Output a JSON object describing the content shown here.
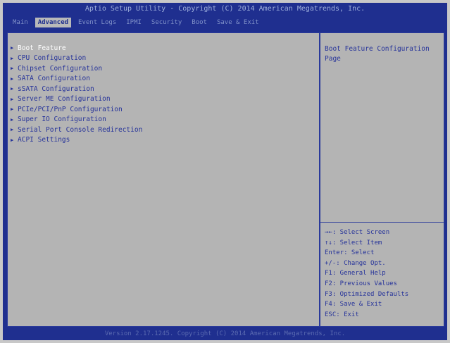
{
  "header": {
    "title": "Aptio Setup Utility - Copyright (C) 2014 American Megatrends, Inc."
  },
  "tabs": [
    {
      "label": "Main"
    },
    {
      "label": "Advanced"
    },
    {
      "label": "Event Logs"
    },
    {
      "label": "IPMI"
    },
    {
      "label": "Security"
    },
    {
      "label": "Boot"
    },
    {
      "label": "Save & Exit"
    }
  ],
  "menu": {
    "items": [
      {
        "label": "Boot Feature"
      },
      {
        "label": "CPU Configuration"
      },
      {
        "label": "Chipset Configuration"
      },
      {
        "label": "SATA Configuration"
      },
      {
        "label": "sSATA Configuration"
      },
      {
        "label": "Server ME Configuration"
      },
      {
        "label": "PCIe/PCI/PnP Configuration"
      },
      {
        "label": "Super IO Configuration"
      },
      {
        "label": "Serial Port Console Redirection"
      },
      {
        "label": "ACPI Settings"
      }
    ]
  },
  "help": {
    "text": "Boot Feature Configuration Page"
  },
  "keys": [
    {
      "label": "→←: Select Screen"
    },
    {
      "label": "↑↓: Select Item"
    },
    {
      "label": "Enter: Select"
    },
    {
      "label": "+/-: Change Opt."
    },
    {
      "label": "F1: General Help"
    },
    {
      "label": "F2: Previous Values"
    },
    {
      "label": "F3: Optimized Defaults"
    },
    {
      "label": "F4: Save & Exit"
    },
    {
      "label": "ESC: Exit"
    }
  ],
  "footer": {
    "text": "Version 2.17.1245. Copyright (C) 2014 American Megatrends, Inc."
  },
  "colors": {
    "bios_blue": "#1f2f8f",
    "panel_gray": "#b4b4b4",
    "text_blue": "#26339a",
    "selected_white": "#ffffff"
  }
}
